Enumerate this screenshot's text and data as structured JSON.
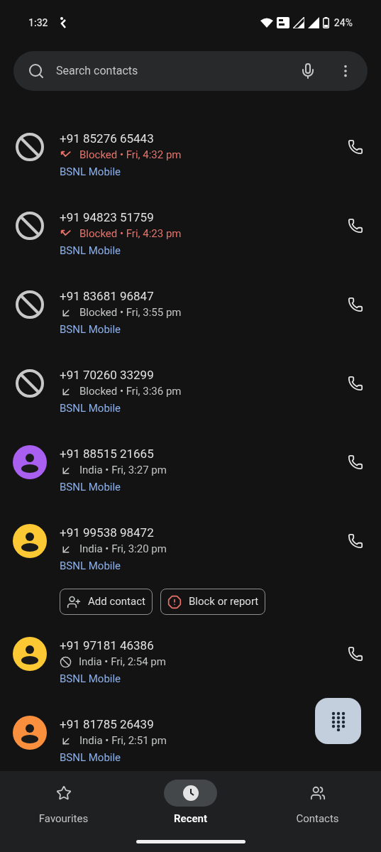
{
  "status_bar": {
    "time": "1:32",
    "battery": "24%"
  },
  "search": {
    "placeholder": "Search contacts"
  },
  "calls": [
    {
      "number": "+91 85276 65443",
      "avatar": {
        "kind": "blocked"
      },
      "call_icon": {
        "kind": "missed"
      },
      "detail": "Blocked • Fri, 4:32 pm",
      "carrier": "BSNL Mobile",
      "expanded": false,
      "call_button": true
    },
    {
      "number": "+91 94823 51759",
      "avatar": {
        "kind": "blocked"
      },
      "call_icon": {
        "kind": "missed"
      },
      "detail": "Blocked • Fri, 4:23 pm",
      "carrier": "BSNL Mobile",
      "expanded": false,
      "call_button": true
    },
    {
      "number": "+91 83681 96847",
      "avatar": {
        "kind": "blocked"
      },
      "call_icon": {
        "kind": "incoming"
      },
      "detail": "Blocked • Fri, 3:55 pm",
      "carrier": "BSNL Mobile",
      "expanded": false,
      "call_button": true
    },
    {
      "number": "+91 70260 33299",
      "avatar": {
        "kind": "blocked"
      },
      "call_icon": {
        "kind": "incoming"
      },
      "detail": "Blocked • Fri, 3:36 pm",
      "carrier": "BSNL Mobile",
      "expanded": false,
      "call_button": true
    },
    {
      "number": "+91 88515 21665",
      "avatar": {
        "kind": "person",
        "color": "#a95ff0"
      },
      "call_icon": {
        "kind": "incoming"
      },
      "detail": "India • Fri, 3:27 pm",
      "carrier": "BSNL Mobile",
      "expanded": false,
      "call_button": true
    },
    {
      "number": "+91 99538 98472",
      "avatar": {
        "kind": "person",
        "color": "#fcc934"
      },
      "call_icon": {
        "kind": "incoming"
      },
      "detail": "India • Fri, 3:20 pm",
      "carrier": "BSNL Mobile",
      "expanded": true,
      "call_button": true
    },
    {
      "number": "+91 97181 46386",
      "avatar": {
        "kind": "person",
        "color": "#fcc934"
      },
      "call_icon": {
        "kind": "blocked"
      },
      "detail": "India • Fri, 2:54 pm",
      "carrier": "BSNL Mobile",
      "expanded": false,
      "call_button": true
    },
    {
      "number": "+91 81785 26439",
      "avatar": {
        "kind": "person",
        "color": "#fa903e"
      },
      "call_icon": {
        "kind": "incoming"
      },
      "detail": "India • Fri, 2:51 pm",
      "carrier": "BSNL Mobile",
      "expanded": false,
      "call_button": false
    }
  ],
  "row_actions": [
    {
      "kind": "add",
      "label": "Add contact"
    },
    {
      "kind": "report",
      "label": "Block or report"
    }
  ],
  "nav": [
    {
      "kind": "favourites",
      "label": "Favourites",
      "selected": false
    },
    {
      "kind": "recent",
      "label": "Recent",
      "selected": true
    },
    {
      "kind": "contacts",
      "label": "Contacts",
      "selected": false
    }
  ]
}
